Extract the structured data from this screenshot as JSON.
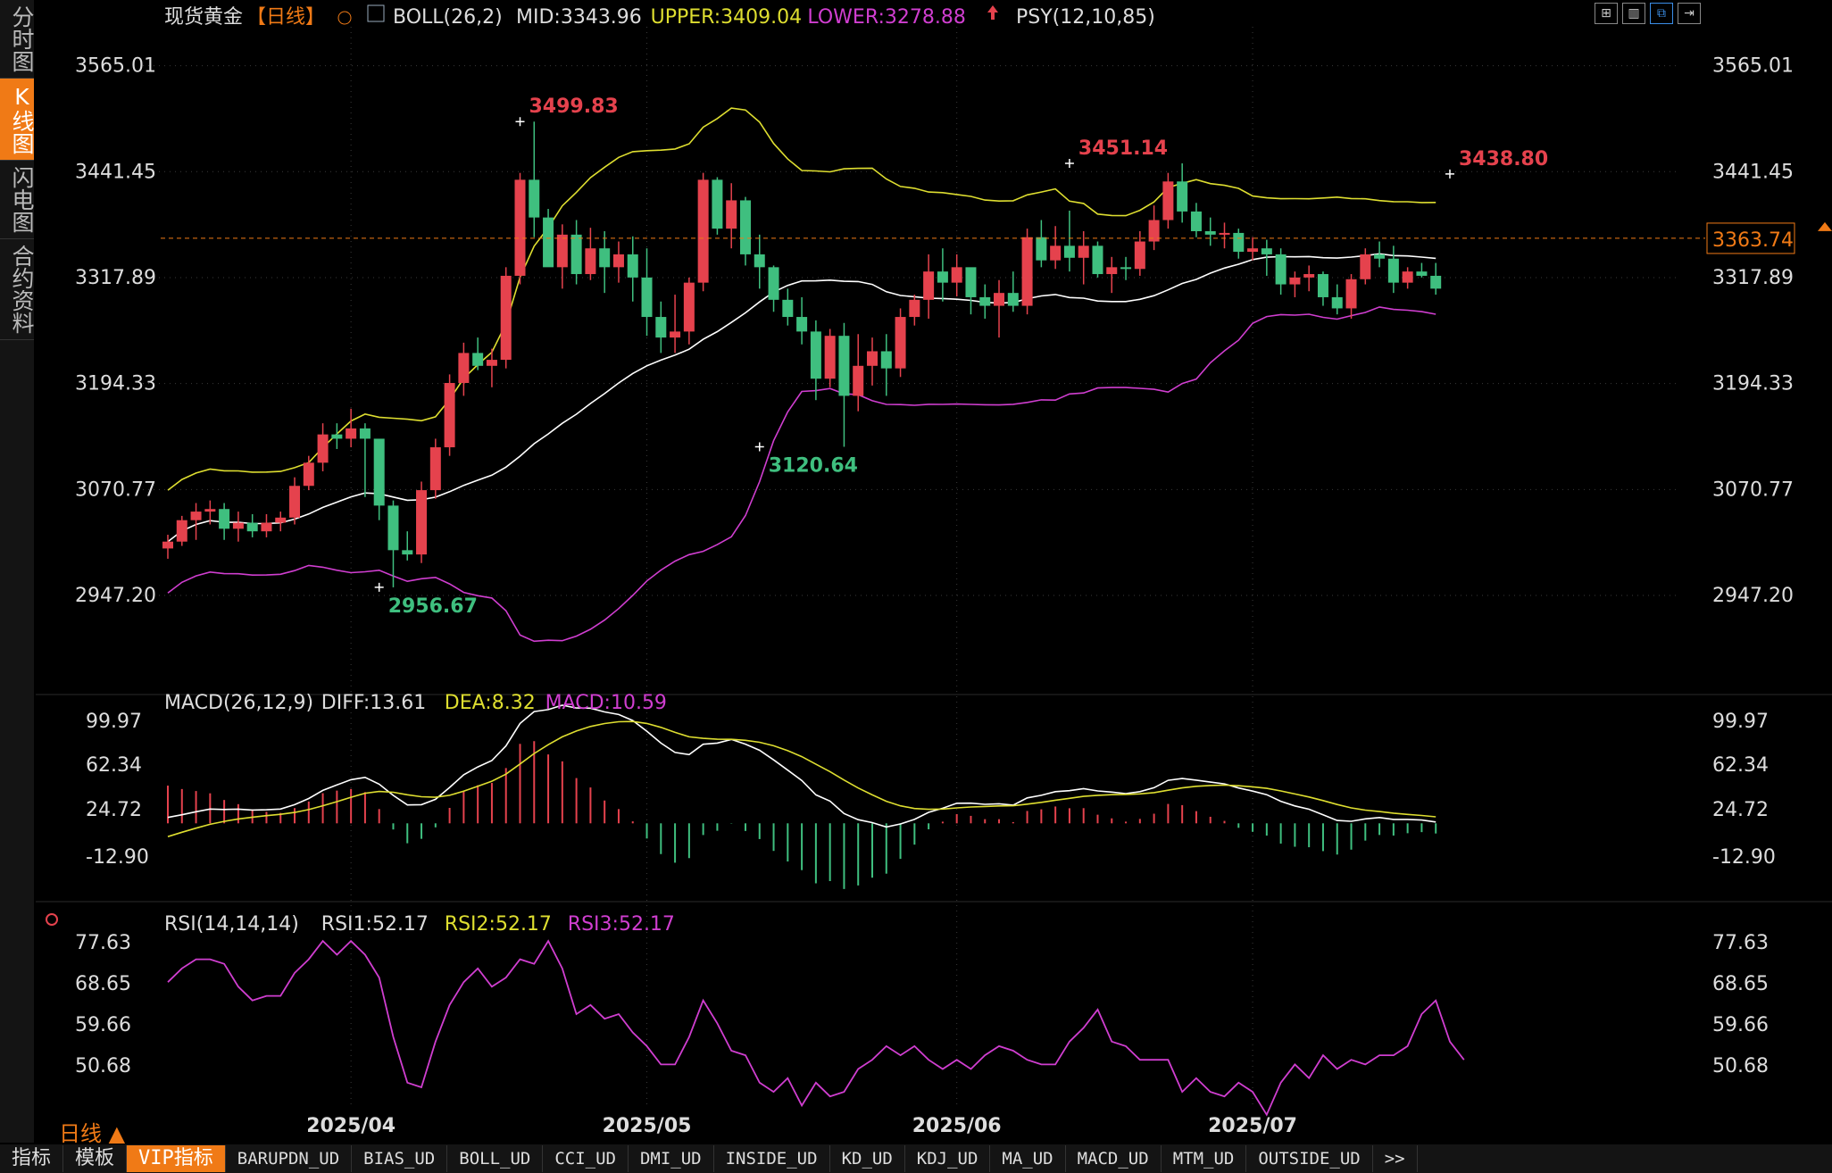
{
  "sidebar": [
    {
      "label": "分时图",
      "active": false
    },
    {
      "label": "K线图",
      "active": true
    },
    {
      "label": "闪电图",
      "active": false
    },
    {
      "label": "合约资料",
      "active": false
    }
  ],
  "toolbar_icons": [
    "grid-layout-icon",
    "window-layout-icon",
    "split-layout-icon",
    "exit-layout-icon"
  ],
  "period_label": "日线 ▲",
  "bottom_tabs": [
    {
      "label": "指标",
      "active": false,
      "small": false
    },
    {
      "label": "模板",
      "active": false,
      "small": false
    },
    {
      "label": "VIP指标",
      "active": true,
      "small": false
    },
    {
      "label": "BARUPDN_UD",
      "active": false,
      "small": true
    },
    {
      "label": "BIAS_UD",
      "active": false,
      "small": true
    },
    {
      "label": "BOLL_UD",
      "active": false,
      "small": true
    },
    {
      "label": "CCI_UD",
      "active": false,
      "small": true
    },
    {
      "label": "DMI_UD",
      "active": false,
      "small": true
    },
    {
      "label": "INSIDE_UD",
      "active": false,
      "small": true
    },
    {
      "label": "KD_UD",
      "active": false,
      "small": true
    },
    {
      "label": "KDJ_UD",
      "active": false,
      "small": true
    },
    {
      "label": "MA_UD",
      "active": false,
      "small": true
    },
    {
      "label": "MACD_UD",
      "active": false,
      "small": true
    },
    {
      "label": "MTM_UD",
      "active": false,
      "small": true
    },
    {
      "label": "OUTSIDE_UD",
      "active": false,
      "small": true
    },
    {
      "label": ">>",
      "active": false,
      "small": true
    }
  ],
  "colors": {
    "up": "#e5424d",
    "down": "#3fbf7f",
    "mid": "#ffffff",
    "upper": "#dede30",
    "lower": "#d03ed0",
    "diff": "#ffffff",
    "dea": "#dede30",
    "rsi": "#d03ed0",
    "accent": "#f07a16",
    "grid": "#3a3a3a"
  },
  "chart_data": [
    {
      "type": "candlestick",
      "title": "现货黄金",
      "period": "【日线】",
      "legend": [
        {
          "text": "BOLL(26,2)",
          "color": "#dddddd"
        },
        {
          "text": "MID:3343.96",
          "color": "#dddddd"
        },
        {
          "text": "UPPER:3409.04",
          "color": "#dede30"
        },
        {
          "text": "LOWER:3278.88",
          "color": "#d03ed0"
        },
        {
          "text": "PSY(12,10,85)",
          "color": "#dddddd"
        }
      ],
      "y_ticks": [
        "3565.01",
        "3441.45",
        "3317.89",
        "3194.33",
        "3070.77",
        "2947.20"
      ],
      "ylim": [
        2840,
        3600
      ],
      "x_ticks": [
        {
          "label": "2025/04",
          "index": 13
        },
        {
          "label": "2025/05",
          "index": 34
        },
        {
          "label": "2025/06",
          "index": 56
        },
        {
          "label": "2025/07",
          "index": 77
        }
      ],
      "last_price": "3363.74",
      "annotations": [
        {
          "text": "3499.83",
          "index": 25,
          "value": 3499.83,
          "kind": "high"
        },
        {
          "text": "2956.67",
          "index": 15,
          "value": 2956.67,
          "kind": "low"
        },
        {
          "text": "3120.64",
          "index": 42,
          "value": 3120.64,
          "kind": "low"
        },
        {
          "text": "3451.14",
          "index": 64,
          "value": 3451.14,
          "kind": "high"
        },
        {
          "text": "3438.80",
          "index": 91,
          "value": 3438.8,
          "kind": "high"
        }
      ],
      "ohlc": [
        [
          3002,
          3018,
          2990,
          3010
        ],
        [
          3010,
          3040,
          3005,
          3035
        ],
        [
          3035,
          3055,
          3012,
          3045
        ],
        [
          3045,
          3058,
          3030,
          3048
        ],
        [
          3048,
          3055,
          3012,
          3025
        ],
        [
          3025,
          3045,
          3010,
          3032
        ],
        [
          3032,
          3042,
          3015,
          3022
        ],
        [
          3022,
          3042,
          3015,
          3032
        ],
        [
          3032,
          3045,
          3022,
          3038
        ],
        [
          3038,
          3085,
          3030,
          3075
        ],
        [
          3075,
          3110,
          3070,
          3102
        ],
        [
          3102,
          3148,
          3092,
          3135
        ],
        [
          3135,
          3148,
          3118,
          3130
        ],
        [
          3130,
          3165,
          3120,
          3142
        ],
        [
          3142,
          3148,
          3062,
          3130
        ],
        [
          3130,
          3112,
          3035,
          3052
        ],
        [
          3052,
          3058,
          2956.67,
          3000
        ],
        [
          3000,
          3022,
          2988,
          2995
        ],
        [
          2995,
          3080,
          2985,
          3070
        ],
        [
          3070,
          3130,
          3060,
          3120
        ],
        [
          3120,
          3205,
          3110,
          3195
        ],
        [
          3195,
          3242,
          3180,
          3230
        ],
        [
          3230,
          3248,
          3210,
          3215
        ],
        [
          3215,
          3235,
          3190,
          3222
        ],
        [
          3222,
          3330,
          3212,
          3320
        ],
        [
          3320,
          3440,
          3310,
          3432
        ],
        [
          3432,
          3499.83,
          3365,
          3388
        ],
        [
          3388,
          3398,
          3340,
          3330
        ],
        [
          3330,
          3380,
          3305,
          3368
        ],
        [
          3368,
          3385,
          3310,
          3322
        ],
        [
          3322,
          3376,
          3315,
          3352
        ],
        [
          3352,
          3372,
          3300,
          3330
        ],
        [
          3330,
          3360,
          3312,
          3345
        ],
        [
          3345,
          3366,
          3290,
          3318
        ],
        [
          3318,
          3352,
          3250,
          3272
        ],
        [
          3272,
          3290,
          3230,
          3248
        ],
        [
          3248,
          3298,
          3230,
          3255
        ],
        [
          3255,
          3318,
          3240,
          3312
        ],
        [
          3312,
          3440,
          3302,
          3432
        ],
        [
          3432,
          3435,
          3368,
          3375
        ],
        [
          3375,
          3428,
          3352,
          3408
        ],
        [
          3408,
          3412,
          3332,
          3345
        ],
        [
          3345,
          3368,
          3305,
          3330
        ],
        [
          3330,
          3332,
          3278,
          3292
        ],
        [
          3292,
          3305,
          3262,
          3272
        ],
        [
          3272,
          3295,
          3240,
          3255
        ],
        [
          3255,
          3268,
          3175,
          3200
        ],
        [
          3200,
          3258,
          3190,
          3250
        ],
        [
          3250,
          3265,
          3120.64,
          3180
        ],
        [
          3180,
          3252,
          3162,
          3215
        ],
        [
          3215,
          3248,
          3192,
          3232
        ],
        [
          3232,
          3252,
          3180,
          3212
        ],
        [
          3212,
          3282,
          3202,
          3272
        ],
        [
          3272,
          3298,
          3262,
          3292
        ],
        [
          3292,
          3345,
          3270,
          3325
        ],
        [
          3325,
          3352,
          3290,
          3312
        ],
        [
          3312,
          3345,
          3296,
          3330
        ],
        [
          3330,
          3322,
          3275,
          3295
        ],
        [
          3295,
          3310,
          3270,
          3285
        ],
        [
          3285,
          3315,
          3248,
          3300
        ],
        [
          3300,
          3325,
          3278,
          3285
        ],
        [
          3285,
          3375,
          3275,
          3365
        ],
        [
          3365,
          3385,
          3330,
          3338
        ],
        [
          3338,
          3378,
          3328,
          3355
        ],
        [
          3355,
          3396,
          3325,
          3341
        ],
        [
          3341,
          3372,
          3310,
          3355
        ],
        [
          3355,
          3360,
          3318,
          3322
        ],
        [
          3322,
          3342,
          3300,
          3330
        ],
        [
          3330,
          3342,
          3315,
          3328
        ],
        [
          3328,
          3372,
          3320,
          3360
        ],
        [
          3360,
          3402,
          3350,
          3385
        ],
        [
          3385,
          3440,
          3375,
          3430
        ],
        [
          3430,
          3451.14,
          3382,
          3395
        ],
        [
          3395,
          3405,
          3365,
          3372
        ],
        [
          3372,
          3388,
          3355,
          3368
        ],
        [
          3368,
          3382,
          3352,
          3370
        ],
        [
          3370,
          3375,
          3340,
          3348
        ],
        [
          3348,
          3365,
          3338,
          3352
        ],
        [
          3352,
          3362,
          3320,
          3345
        ],
        [
          3345,
          3352,
          3298,
          3310
        ],
        [
          3310,
          3325,
          3295,
          3318
        ],
        [
          3318,
          3332,
          3302,
          3322
        ],
        [
          3322,
          3325,
          3285,
          3295
        ],
        [
          3295,
          3310,
          3275,
          3282
        ],
        [
          3282,
          3322,
          3270,
          3316
        ],
        [
          3316,
          3352,
          3310,
          3345
        ],
        [
          3345,
          3360,
          3330,
          3340
        ],
        [
          3340,
          3355,
          3300,
          3312
        ],
        [
          3312,
          3330,
          3305,
          3325
        ],
        [
          3325,
          3335,
          3318,
          3320
        ],
        [
          3320,
          3335,
          3298,
          3305
        ]
      ]
    },
    {
      "type": "line",
      "title": "MACD(26,12,9)",
      "legend": [
        {
          "text": "MACD(26,12,9)",
          "color": "#dddddd"
        },
        {
          "text": "DIFF:13.61",
          "color": "#dddddd"
        },
        {
          "text": "DEA:8.32",
          "color": "#dede30"
        },
        {
          "text": "MACD:10.59",
          "color": "#d03ed0"
        }
      ],
      "y_ticks": [
        "99.97",
        "62.34",
        "24.72",
        "-12.90"
      ]
    },
    {
      "type": "line",
      "title": "RSI(14,14,14)",
      "legend": [
        {
          "text": "RSI(14,14,14)",
          "color": "#dddddd"
        },
        {
          "text": "RSI1:52.17",
          "color": "#dddddd"
        },
        {
          "text": "RSI2:52.17",
          "color": "#dede30"
        },
        {
          "text": "RSI3:52.17",
          "color": "#d03ed0"
        }
      ],
      "y_ticks": [
        "77.63",
        "68.65",
        "59.66",
        "50.68"
      ],
      "ylim": [
        44,
        80
      ],
      "series": [
        {
          "values": [
            69,
            72,
            74,
            74,
            73,
            68,
            65,
            66,
            66,
            71,
            74,
            78,
            75,
            78,
            75,
            70,
            57,
            47,
            46,
            56,
            64,
            69,
            72,
            68,
            70,
            74,
            73,
            78,
            72,
            62,
            64,
            61,
            62,
            58,
            55,
            51,
            51,
            57,
            65,
            60,
            54,
            53,
            47,
            45,
            48,
            42,
            47,
            44,
            45,
            50,
            52,
            55,
            53,
            55,
            52,
            50,
            52,
            50,
            53,
            55,
            54,
            52,
            51,
            51,
            56,
            59,
            63,
            56,
            55,
            52,
            52,
            52,
            45,
            48,
            45,
            44,
            47,
            45,
            40,
            47,
            51,
            48,
            53,
            50,
            52,
            51,
            53,
            53,
            55,
            62,
            65,
            56,
            52
          ]
        }
      ]
    }
  ]
}
